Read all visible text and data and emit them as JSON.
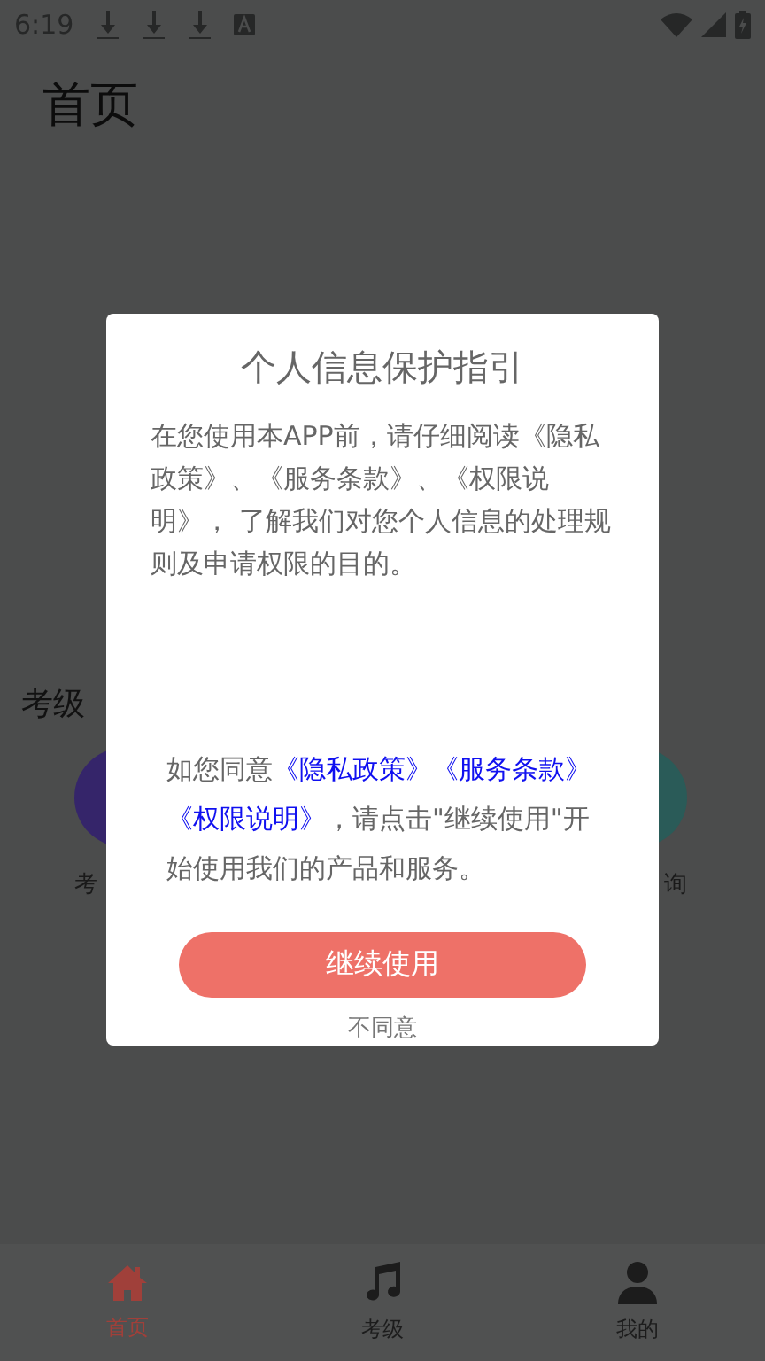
{
  "status_bar": {
    "time": "6:19"
  },
  "header": {
    "title": "首页"
  },
  "section": {
    "title": "考级"
  },
  "shortcuts": [
    {
      "label": "考",
      "color": "#35256a"
    },
    {
      "label": "询",
      "color": "#2a5b58"
    }
  ],
  "dialog": {
    "title": "个人信息保护指引",
    "intro": "在您使用本APP前，请仔细阅读《隐私政策》、《服务条款》、《权限说明》， 了解我们对您个人信息的处理规则及申请权限的目的。",
    "consent": [
      {
        "kind": "plain",
        "text": "如您同意"
      },
      {
        "kind": "link",
        "text": "《隐私政策》"
      },
      {
        "kind": "link",
        "text": "《服务条款》"
      },
      {
        "kind": "link",
        "text": "《权限说明》"
      },
      {
        "kind": "plain",
        "text": "，请点击\"继续使用\"开始使用我们的产品和服务。"
      }
    ],
    "accept_button": "继续使用",
    "decline_link": "不同意"
  },
  "tabs": [
    {
      "label": "首页",
      "selected": true
    },
    {
      "label": "考级",
      "selected": false
    },
    {
      "label": "我的",
      "selected": false
    }
  ]
}
